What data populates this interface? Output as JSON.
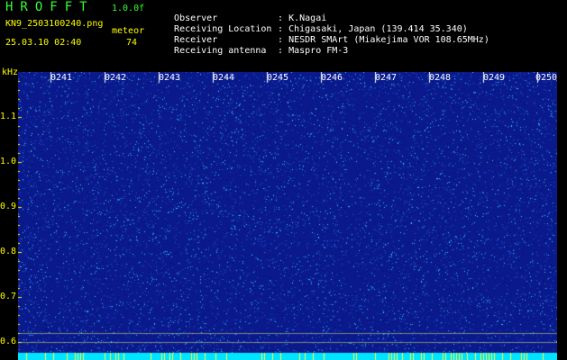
{
  "header": {
    "app_title": "HROFFT",
    "version": "1.0.0f",
    "filename": "KN9_2503100240.png",
    "meteor_label": "meteor",
    "timestamp": "25.03.10 02:40",
    "meteor_count": "74"
  },
  "info": [
    {
      "label": "Observer",
      "value": ": K.Nagai"
    },
    {
      "label": "Receiving Location",
      "value": ": Chigasaki, Japan (139.414 35.340)"
    },
    {
      "label": "Receiver",
      "value": ": NESDR SMArt (Miakejima VOR 108.65MHz)"
    },
    {
      "label": "Receiving antenna",
      "value": ": Maspro FM-3"
    }
  ],
  "axis": {
    "y_unit": "kHz",
    "y_ticks": [
      "1.1",
      "1.0",
      "0.9",
      "0.8",
      "0.7",
      "0.6"
    ],
    "x_ticks": [
      "0241",
      "0242",
      "0243",
      "0244",
      "0245",
      "0246",
      "0247",
      "0248",
      "0249",
      "0250"
    ]
  },
  "colors": {
    "background": "#0a1a8c",
    "noise_bright": "#33ccff",
    "noise_mid": "#1e55d8",
    "noise_dark": "#07106a",
    "axis_text": "#ffff00",
    "title_text": "#33ff33"
  }
}
